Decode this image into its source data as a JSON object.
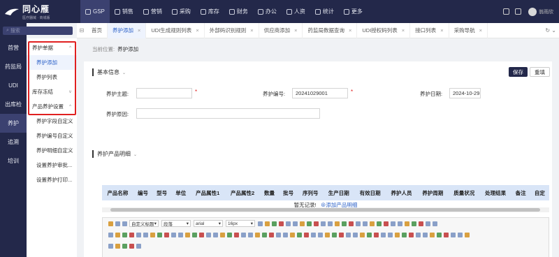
{
  "brand": {
    "name": "同心雁",
    "sub": "医疗器械 · 商城版"
  },
  "topnav": [
    {
      "label": "GSP",
      "icon": "grid-icon",
      "active": true
    },
    {
      "label": "销售",
      "icon": "chart-icon"
    },
    {
      "label": "营销",
      "icon": "megaphone-icon"
    },
    {
      "label": "采购",
      "icon": "cart-icon"
    },
    {
      "label": "库存",
      "icon": "box-icon"
    },
    {
      "label": "财务",
      "icon": "money-icon"
    },
    {
      "label": "办公",
      "icon": "folder-icon"
    },
    {
      "label": "人资",
      "icon": "user-icon"
    },
    {
      "label": "统计",
      "icon": "stats-icon"
    },
    {
      "label": "更多",
      "icon": "more-icon"
    }
  ],
  "user": {
    "name": "翁雨欣"
  },
  "search": {
    "placeholder": "搜索"
  },
  "sidebar1": [
    "首营",
    "药监局",
    "UDI",
    "出库检",
    "养护",
    "追溯",
    "培训"
  ],
  "sidebar2": [
    {
      "label": "养护单据",
      "type": "grp",
      "chev": "^"
    },
    {
      "label": "养护添加",
      "type": "sub",
      "sel": true
    },
    {
      "label": "养护列表",
      "type": "sub"
    },
    {
      "label": "库存冻结",
      "type": "grp",
      "chev": "v"
    },
    {
      "label": "产品养护设置",
      "type": "grp",
      "chev": "^"
    },
    {
      "label": "养护字段自定义",
      "type": "sub"
    },
    {
      "label": "养护编号自定义",
      "type": "sub"
    },
    {
      "label": "养护明细自定义",
      "type": "sub"
    },
    {
      "label": "设置养护审批...",
      "type": "sub"
    },
    {
      "label": "设置养护打印...",
      "type": "sub"
    }
  ],
  "tabs": [
    "首页",
    "养护添加",
    "UDI生成规则列表",
    "外部码识别规则",
    "供应商添加",
    "药监局数据查询",
    "UDI授权码列表",
    "接口列表",
    "采购导航"
  ],
  "breadcrumb": {
    "prefix": "当前位置:",
    "current": "养护添加"
  },
  "basic": {
    "title": "基本信息",
    "save": "保存",
    "reset": "重填",
    "fields": {
      "subject": {
        "label": "养护主题:",
        "value": ""
      },
      "number": {
        "label": "养护编号:",
        "value": "20241029001"
      },
      "date": {
        "label": "养护日期:",
        "value": "2024-10-29"
      },
      "reason": {
        "label": "养护原因:",
        "value": ""
      }
    }
  },
  "detail": {
    "title": "养护产品明细",
    "columns": [
      "产品名称",
      "编号",
      "型号",
      "单位",
      "产品属性1",
      "产品属性2",
      "数量",
      "批号",
      "序列号",
      "生产日期",
      "有效日期",
      "养护人员",
      "养护周期",
      "质量状况",
      "处理结果",
      "备注",
      "自定"
    ],
    "empty": "暂无记录!",
    "add_link": "添加产品明细"
  },
  "editor": {
    "style_sel": "自定义标题",
    "para_sel": "段落",
    "font_sel": "arial",
    "size_sel": "16px"
  },
  "colors": {
    "nav": "#23284a",
    "navActive": "#3b4170",
    "link": "#2a60c8",
    "highlight": "#e02020"
  }
}
